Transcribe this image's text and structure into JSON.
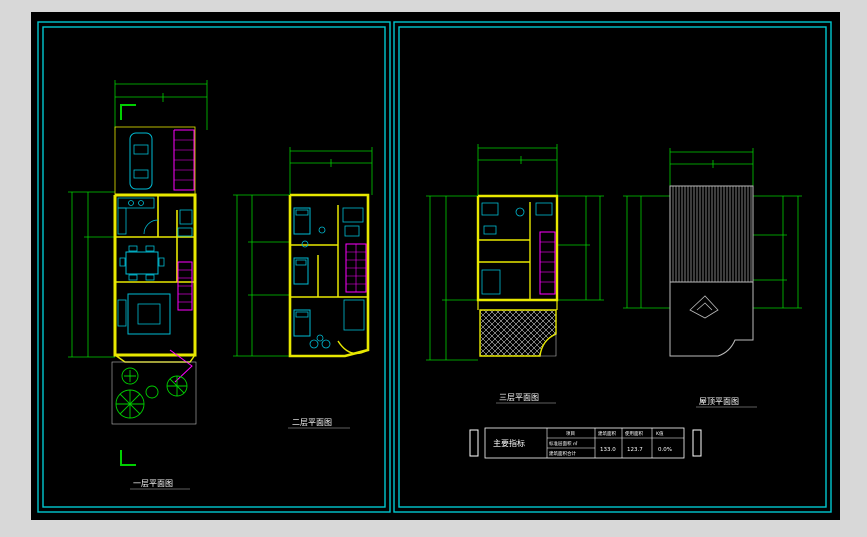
{
  "canvas": {
    "background": "#000000",
    "frame_color": "#00c8d0",
    "wall_color": "#e8e800",
    "furniture_color": "#00bcd4",
    "dim_color": "#00d000",
    "stair_color": "#ff00ff",
    "text_color": "#ffffff"
  },
  "plans": {
    "first": {
      "title": "一层平面图"
    },
    "second": {
      "title": "二层平面图"
    },
    "third": {
      "title": "三层平面图"
    },
    "roof": {
      "title": "屋顶平面图"
    }
  },
  "table": {
    "title": "主要指标",
    "headers": [
      "项目",
      "建筑面积",
      "使用面积",
      "K值"
    ],
    "row_labels": [
      "标准层面积 ㎡",
      "建筑面积合计"
    ],
    "values": [
      "133.0",
      "123.7",
      "0.0%"
    ]
  }
}
